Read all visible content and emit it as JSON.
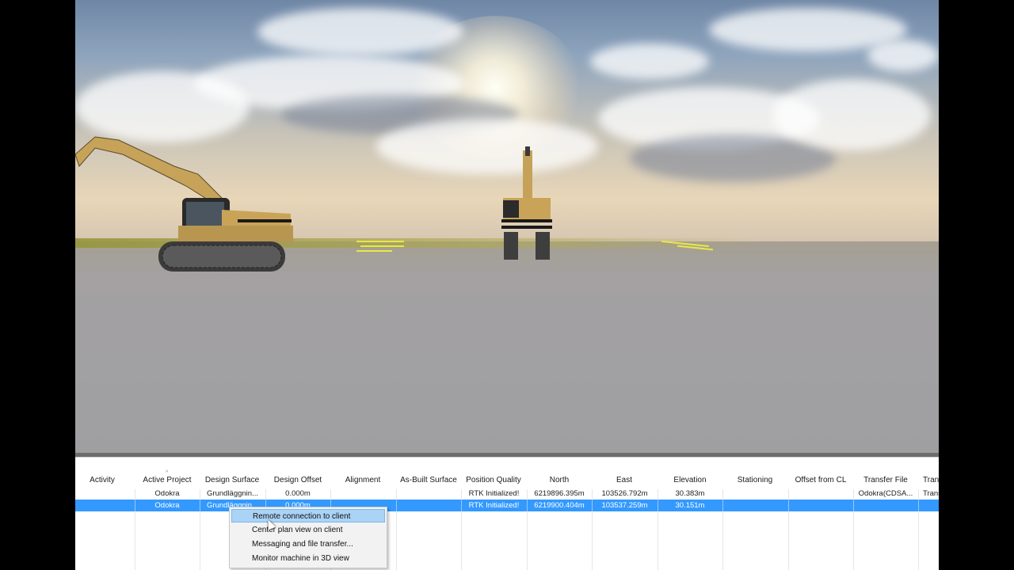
{
  "scene": {
    "label": "3D machine view"
  },
  "table": {
    "columns": [
      "Activity",
      "Active Project",
      "Design Surface",
      "Design Offset",
      "Alignment",
      "As-Built Surface",
      "Position Quality",
      "North",
      "East",
      "Elevation",
      "Stationing",
      "Offset from CL",
      "Transfer File",
      "Tran"
    ],
    "rows": [
      [
        "",
        "Odokra",
        "Grundläggnin...",
        "0.000m",
        "",
        "",
        "RTK Initialized!",
        "6219896.395m",
        "103526.792m",
        "30.383m",
        "",
        "",
        "Odokra(CDSA...",
        "Trans"
      ],
      [
        "",
        "Odokra",
        "Grundläggnin...",
        "0.000m",
        "",
        "",
        "RTK Initialized!",
        "6219900.404m",
        "103537.259m",
        "30.151m",
        "",
        "",
        "",
        ""
      ]
    ],
    "selected_row": 1
  },
  "context_menu": {
    "items": [
      "Remote connection to client",
      "Center plan view on client",
      "Messaging and file transfer...",
      "Monitor machine in 3D view"
    ],
    "highlighted": 0
  }
}
